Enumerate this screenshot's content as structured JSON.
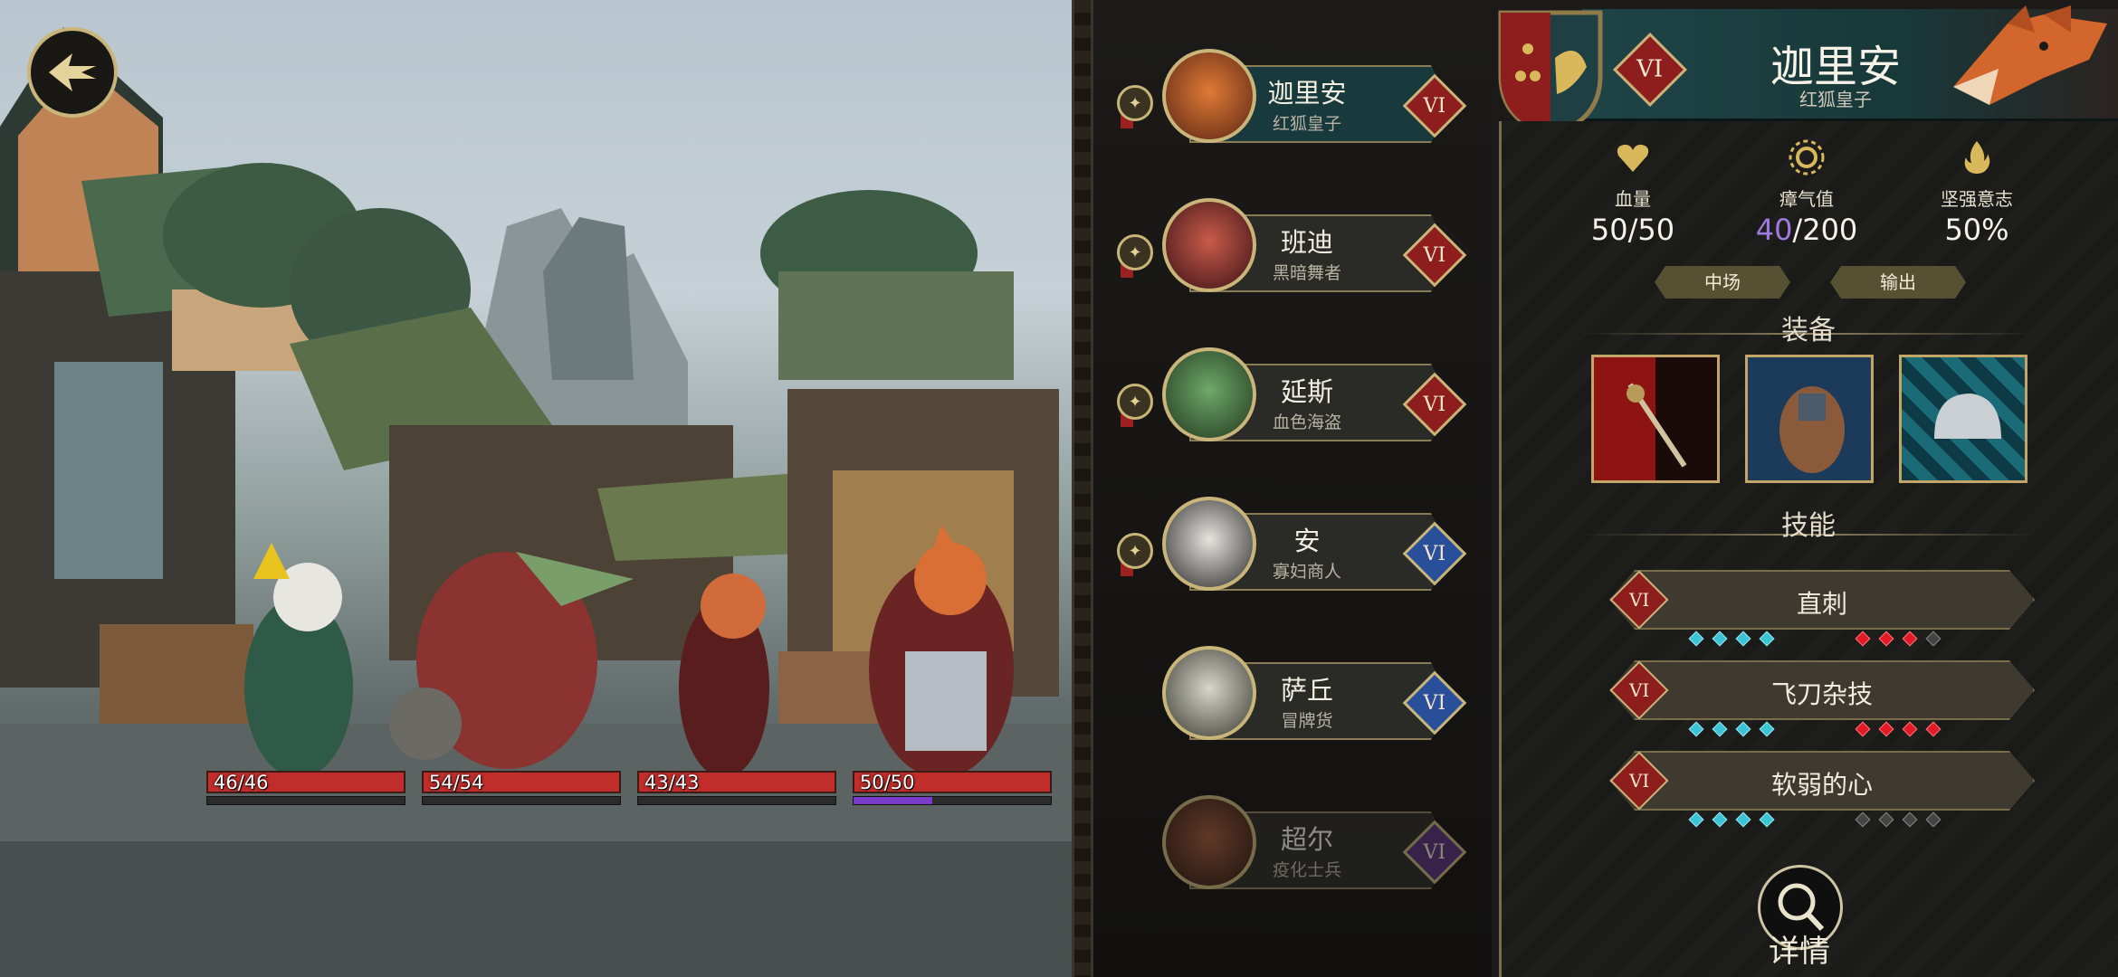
{
  "scene": {
    "health_bars": [
      {
        "text": "46/46",
        "fill": 1.0,
        "sub_fill": 0.0
      },
      {
        "text": "54/54",
        "fill": 1.0,
        "sub_fill": 0.0
      },
      {
        "text": "43/43",
        "fill": 1.0,
        "sub_fill": 0.0
      },
      {
        "text": "50/50",
        "fill": 1.0,
        "sub_fill": 0.4
      }
    ]
  },
  "roster": [
    {
      "name": "迦里安",
      "title": "红狐皇子",
      "tier": "VI",
      "tier_color": "red"
    },
    {
      "name": "班迪",
      "title": "黑暗舞者",
      "tier": "VI",
      "tier_color": "red"
    },
    {
      "name": "延斯",
      "title": "血色海盗",
      "tier": "VI",
      "tier_color": "red"
    },
    {
      "name": "安",
      "title": "寡妇商人",
      "tier": "VI",
      "tier_color": "blue"
    },
    {
      "name": "萨丘",
      "title": "冒牌货",
      "tier": "VI",
      "tier_color": "blue"
    },
    {
      "name": "超尔",
      "title": "疫化士兵",
      "tier": "VI",
      "tier_color": "purple"
    }
  ],
  "detail": {
    "tier": "VI",
    "name": "迦里安",
    "subtitle": "红狐皇子",
    "stats": {
      "hp_label": "血量",
      "hp_value": "50/50",
      "stress_label": "瘴气值",
      "stress_current": "40",
      "stress_max": "/200",
      "will_label": "坚强意志",
      "will_value": "50%"
    },
    "tags": [
      "中场",
      "输出"
    ],
    "equipment_title": "装备",
    "skills_title": "技能",
    "skills": [
      {
        "name": "直刺",
        "tier": "VI",
        "blue_dots": 4,
        "red_dots": 3,
        "empty_red": 1
      },
      {
        "name": "飞刀杂技",
        "tier": "VI",
        "blue_dots": 4,
        "red_dots": 4,
        "empty_red": 0
      },
      {
        "name": "软弱的心",
        "tier": "VI",
        "blue_dots": 4,
        "red_dots": 0,
        "empty_red": 4
      }
    ],
    "detail_button": "详情"
  },
  "colors": {
    "hp_red": "#c12d2a",
    "stress_purple": "#a07ae0",
    "tier_red": "#8e1d1d",
    "tier_blue": "#2a4f9a",
    "tier_purple": "#56307a",
    "gold_trim": "#c9b57a"
  }
}
